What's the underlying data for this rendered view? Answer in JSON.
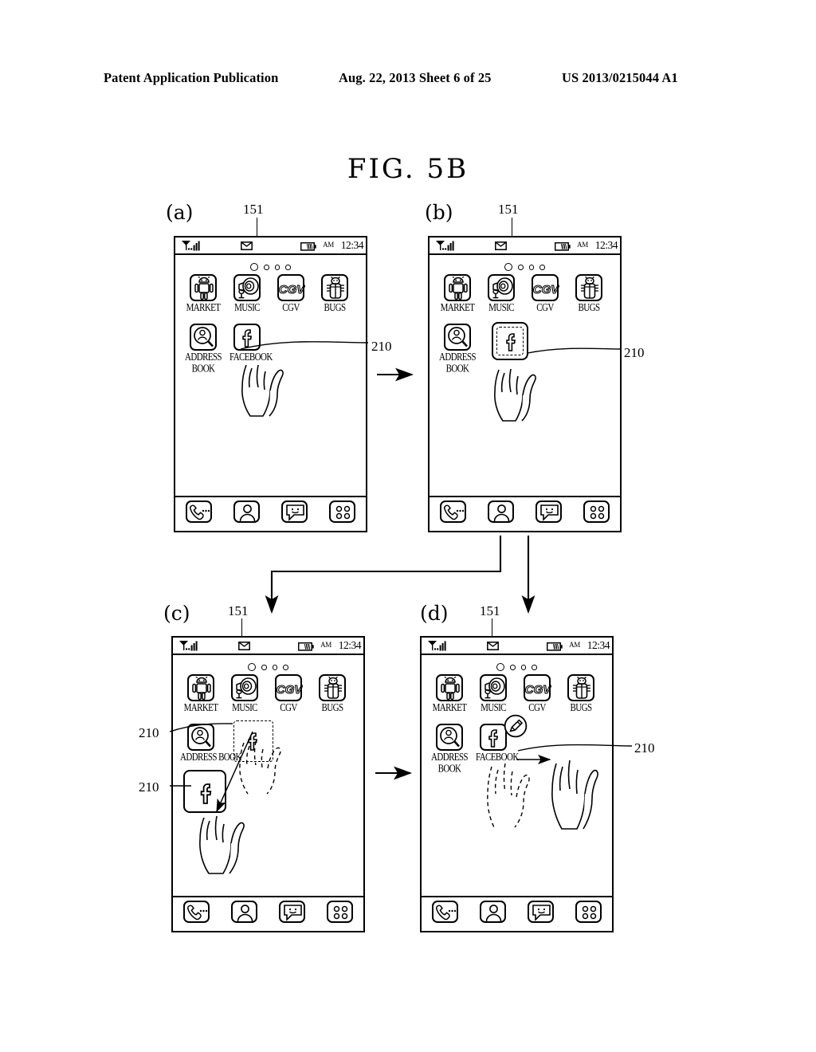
{
  "header": {
    "publication": "Patent Application Publication",
    "date_sheet": "Aug. 22, 2013  Sheet 6 of 25",
    "patent_number": "US 2013/0215044 A1"
  },
  "figure": {
    "title": "FIG.  5B"
  },
  "panels": [
    {
      "id": "a",
      "letter": "(a)",
      "device_ref": "151",
      "callouts": [
        "210"
      ],
      "state": "normal-home-screen-touch-facebook",
      "facebook_label_visible": true,
      "selection_dashed": false,
      "badge": null
    },
    {
      "id": "b",
      "letter": "(b)",
      "device_ref": "151",
      "callouts": [
        "210"
      ],
      "state": "facebook-icon-selected-dashed",
      "facebook_label_visible": false,
      "selection_dashed": true,
      "badge": null
    },
    {
      "id": "c",
      "letter": "(c)",
      "device_ref": "151",
      "callouts": [
        "210",
        "210"
      ],
      "state": "facebook-icon-being-dragged",
      "facebook_label_visible": false,
      "selection_dashed": true,
      "badge": null
    },
    {
      "id": "d",
      "letter": "(d)",
      "device_ref": "151",
      "callouts": [
        "210"
      ],
      "state": "facebook-icon-dropped-with-edit-badge",
      "facebook_label_visible": true,
      "selection_dashed": false,
      "badge": "pencil-edit-badge"
    }
  ],
  "phone": {
    "status_bar": {
      "signal_icon": "signal-bars-icon",
      "mail_icon": "envelope-icon",
      "battery_icon": "battery-icon",
      "ampm": "AM",
      "time": "12:34"
    },
    "page_indicator": {
      "total": 4,
      "active": 1
    },
    "app_rows": [
      [
        {
          "label": "MARKET",
          "icon": "android-robot-icon"
        },
        {
          "label": "MUSIC",
          "icon": "speaker-horn-icon"
        },
        {
          "label": "CGV",
          "icon": "cgv-logo-icon"
        },
        {
          "label": "BUGS",
          "icon": "bug-insect-icon"
        }
      ],
      [
        {
          "label": "ADDRESS BOOK",
          "icon": "person-magnifier-icon"
        },
        {
          "label": "FACEBOOK",
          "icon": "facebook-f-icon"
        }
      ]
    ],
    "dock": [
      {
        "label": "Phone",
        "icon": "phone-handset-icon"
      },
      {
        "label": "Contacts",
        "icon": "person-silhouette-icon"
      },
      {
        "label": "Messages",
        "icon": "chat-smiley-icon"
      },
      {
        "label": "Apps",
        "icon": "apps-grid-icon"
      }
    ]
  },
  "flow_arrows": [
    {
      "from": "a",
      "to": "b",
      "direction": "right"
    },
    {
      "from": "b",
      "to": "c",
      "direction": "down-left-elbow"
    },
    {
      "from": "b",
      "to": "d",
      "direction": "down"
    },
    {
      "from": "c",
      "to": "d",
      "direction": "right"
    }
  ],
  "colors": {
    "ink": "#000000",
    "paper": "#ffffff"
  }
}
